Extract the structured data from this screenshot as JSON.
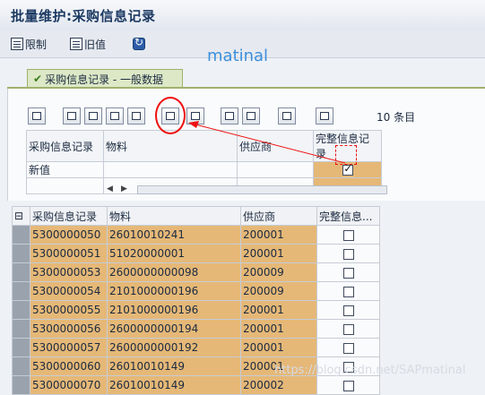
{
  "window": {
    "title": "批量维护:采购信息记录"
  },
  "toolbar": {
    "restrict_label": "限制",
    "old_value_label": "旧值"
  },
  "watermark": {
    "top": "matinal",
    "bottom": "https://blog.csdn.net/SAPmatinal"
  },
  "tab": {
    "label": "采购信息记录 - 一般数据"
  },
  "alv": {
    "count_label": "10 条目"
  },
  "entry_grid": {
    "columns": [
      "采购信息记录",
      "物料",
      "供应商",
      "完整信息记录"
    ],
    "rows": [
      {
        "info_record": "新值",
        "material": "",
        "vendor": "",
        "complete": true
      },
      {
        "info_record": "",
        "material": "",
        "vendor": "",
        "complete": false
      }
    ]
  },
  "list_grid": {
    "columns": [
      "采购信息记录",
      "物料",
      "供应商",
      "完整信息..."
    ],
    "rows": [
      {
        "info_record": "5300000050",
        "material": "26010010241",
        "vendor": "200001",
        "complete": false
      },
      {
        "info_record": "5300000051",
        "material": "51020000001",
        "vendor": "200001",
        "complete": false
      },
      {
        "info_record": "5300000053",
        "material": "2600000000098",
        "vendor": "200009",
        "complete": false
      },
      {
        "info_record": "5300000054",
        "material": "2101000000196",
        "vendor": "200009",
        "complete": false
      },
      {
        "info_record": "5300000055",
        "material": "2101000000196",
        "vendor": "200001",
        "complete": false
      },
      {
        "info_record": "5300000056",
        "material": "2600000000194",
        "vendor": "200001",
        "complete": false
      },
      {
        "info_record": "5300000057",
        "material": "2600000000192",
        "vendor": "200001",
        "complete": false
      },
      {
        "info_record": "5300000060",
        "material": "26010010149",
        "vendor": "200001",
        "complete": false
      },
      {
        "info_record": "5300000070",
        "material": "26010010149",
        "vendor": "200002",
        "complete": false
      }
    ]
  },
  "colors": {
    "highlight": "#e5b877",
    "annotation": "#ee1111"
  }
}
